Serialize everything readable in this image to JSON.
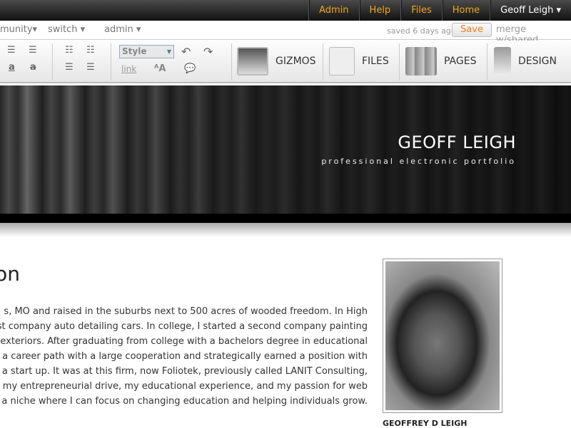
{
  "topnav": [
    "Admin",
    "Help",
    "Files",
    "Home"
  ],
  "user": "Geoff Leigh ▾",
  "subnav": [
    "munity▾",
    "switch ▾",
    "admin ▾"
  ],
  "saved": "saved 6 days ago",
  "save": "Save",
  "merge": "merge w/shared",
  "toolbar": {
    "style": "Style",
    "link": "link",
    "gizmos": "GIZMOS",
    "files": "FILES",
    "pages": "PAGES",
    "design": "DESIGN"
  },
  "banner": {
    "name": "GEOFF LEIGH",
    "tagline": "professional electronic portfolio"
  },
  "content": {
    "heading": "on",
    "lines": [
      "s, MO and raised in the suburbs next to 500 acres of wooded freedom.  In High",
      "irst company auto detailing cars.  In college, I started a second company painting",
      "g exteriors.  After graduating from college with a bachelors degree in educational",
      "aped a career path with a large cooperation and strategically earned a position with",
      "t a start up.   It was at this firm, now Foliotek, previously called LANIT Consulting,",
      "use my entrepreneurial drive, my educational experience, and my passion for web",
      "a niche where I can focus on changing education and helping individuals grow."
    ],
    "caption": "GEOFFREY D LEIGH"
  }
}
